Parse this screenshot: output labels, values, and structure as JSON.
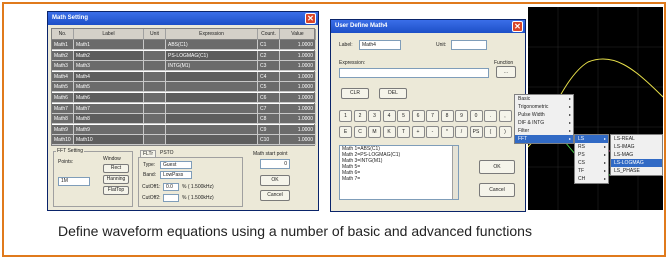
{
  "caption": "Define waveform equations using a number of basic and advanced functions",
  "colors": {
    "frame": "#e07a1c",
    "titlebar": "#1d4fc7",
    "menu_highlight": "#316ac5"
  },
  "math_setting": {
    "title": "Math Setting",
    "columns": [
      "No.",
      "Label",
      "Unit",
      "Expression",
      "Count.",
      "Value"
    ],
    "rows": [
      {
        "no": "Math1",
        "label": "Math1",
        "expr": "ABS(C1)",
        "count": "C1",
        "value": "1.0000"
      },
      {
        "no": "Math2",
        "label": "Math2",
        "expr": "PS-LOGMAG(C1)",
        "count": "C2",
        "value": "1.0000"
      },
      {
        "no": "Math3",
        "label": "Math3",
        "expr": "INTG(M1)",
        "count": "C3",
        "value": "1.0000"
      },
      {
        "no": "Math4",
        "label": "Math4",
        "expr": "",
        "count": "C4",
        "value": "1.0000"
      },
      {
        "no": "Math5",
        "label": "Math5",
        "expr": "",
        "count": "C5",
        "value": "1.0000"
      },
      {
        "no": "Math6",
        "label": "Math6",
        "expr": "",
        "count": "C6",
        "value": "1.0000"
      },
      {
        "no": "Math7",
        "label": "Math7",
        "expr": "",
        "count": "C7",
        "value": "1.0000"
      },
      {
        "no": "Math8",
        "label": "Math8",
        "expr": "",
        "count": "C8",
        "value": "1.0000"
      },
      {
        "no": "Math9",
        "label": "Math9",
        "expr": "",
        "count": "C9",
        "value": "1.0000"
      },
      {
        "no": "Math10",
        "label": "Math10",
        "expr": "",
        "count": "C10",
        "value": "1.0000"
      }
    ],
    "fft": {
      "group_label": "FFT Setting",
      "points_label": "Points:",
      "points_value": "1M",
      "window_label": "Window",
      "window_buttons": [
        "Rect",
        "Hanning",
        "FlatTop"
      ],
      "tabs": [
        "FLTr",
        "PSTO"
      ],
      "type_label": "Type:",
      "type_value": "Guest",
      "band_label": "Band:",
      "band_value": "LowPass",
      "cutoff1_label": "CutOff1:",
      "cutoff1_value": "0.0",
      "cutoff1_unit": "% ( 1.500kHz)",
      "cutoff2_label": "CutOff2:",
      "cutoff2_value": "",
      "cutoff2_unit": "% ( 1.500kHz)"
    },
    "math_start_point_label": "Math start point",
    "math_start_point_value": "0",
    "ok": "OK",
    "cancel": "Cancel"
  },
  "user_define": {
    "title": "User Define Math4",
    "label_label": "Label:",
    "label_value": "Math4",
    "unit_label": "Unit:",
    "unit_value": "",
    "expression_label": "Expression:",
    "function_label": "Function",
    "function_button": "...",
    "clr": "CLR",
    "del": "DEL",
    "keys_row1": [
      "1",
      "2",
      "3",
      "4",
      "5",
      "6",
      "7",
      "8",
      "9",
      "0",
      ".",
      ","
    ],
    "keys_row2": [
      "E",
      "C",
      "M",
      "K",
      "T",
      "+",
      "-",
      "*",
      "/",
      "PS",
      "(",
      ")"
    ],
    "math_list": [
      "Math 1=ABS(C1)",
      "Math 2=PS-LOGMAG(C1)",
      "Math 3=INTG(M1)",
      "Math 5=",
      "Math 6=",
      "Math 7="
    ],
    "ok": "OK",
    "cancel": "Cancel"
  },
  "function_menu": {
    "items": [
      "Basic",
      "Trigonometric",
      "Pulse Width",
      "DIF & INTG",
      "Filter",
      "FFT"
    ],
    "fft_sub": [
      "LS",
      "RS",
      "PS",
      "CS",
      "TF",
      "CH"
    ],
    "ls_sub": [
      "LS-REAL",
      "LS-IMAG",
      "LS-MAG",
      "LS-LOGMAG",
      "LS_PHASE"
    ]
  }
}
